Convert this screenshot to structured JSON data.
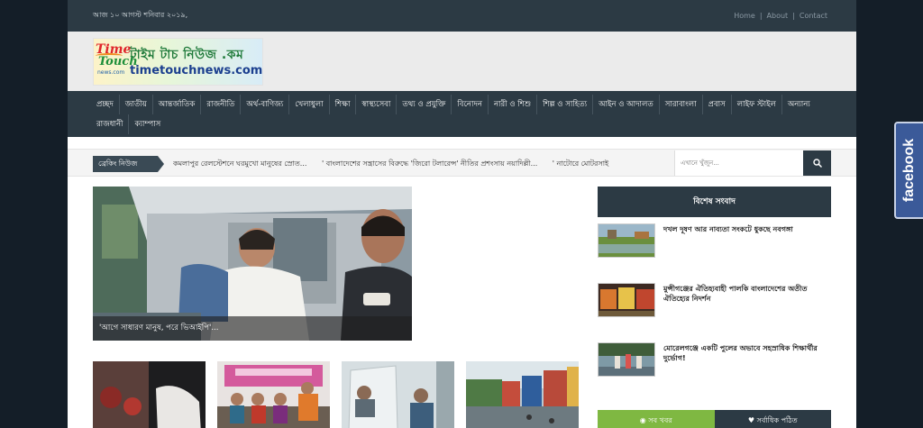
{
  "topbar": {
    "date": "আজ ১০ আগস্ট শনিবার ২০১৯,",
    "links": [
      "Home",
      "About",
      "Contact"
    ]
  },
  "logo": {
    "mark_lines": [
      "Time",
      "Touch",
      "news.com"
    ],
    "bangla": "টাইম টাচ নিউজ .কম",
    "english": "timetouchnews.com"
  },
  "nav": {
    "items": [
      "প্রচ্ছদ",
      "জাতীয়",
      "আন্তর্জাতিক",
      "রাজনীতি",
      "অর্থ-বাণিজ্য",
      "খেলাধুলা",
      "শিক্ষা",
      "স্বাস্থ্যসেবা",
      "তথ্য ও প্রযুক্তি",
      "বিনোদন",
      "নারী ও শিশু",
      "শিল্প ও সাহিত্য",
      "আইন ও আদালত",
      "সারাবাংলা",
      "প্রবাস",
      "লাইফ স্টাইল",
      "অন্যান্য"
    ],
    "items_row2": [
      "রাজধানী",
      "ক্যাম্পাস"
    ]
  },
  "breaking": {
    "label": "ব্রেকিং নিউজ",
    "headlines": [
      "কমলাপুর রেলস্টেশনে ঘরমুখো মানুষের স্রোত...",
      "' বাংলাদেশের সন্ত্রাসের বিরুদ্ধে 'জিরো টলারেন্স' নীতির প্রশংসায় নয়াদিল্লী...",
      "' নাটোরে মোটরসাই"
    ],
    "search_placeholder": "এখানে খুঁজুন..."
  },
  "featured": {
    "caption": "'আগে সাধারণ মানুষ, পরে ভিআইপি'..."
  },
  "sidebar": {
    "heading": "বিশেষ সংবাদ",
    "items": [
      {
        "title": "দখল দূষণ আর নাব্যতা সংকটে ধুকছে নবগঙ্গা"
      },
      {
        "title": "মুন্সীগঞ্জের ঐতিহ্যবাহী পালকি বাংলাদেশের অতীত ঐতিহ্যের নিদর্শন"
      },
      {
        "title": "মোরেলগঞ্জে একটি পুলের অভাবে সহস্রাধিক শিক্ষার্থীর দুর্ভোগ!"
      }
    ],
    "tabs": [
      {
        "label": "সব খবর",
        "icon": "chat-icon"
      },
      {
        "label": "সর্বাধিক পঠিত",
        "icon": "heart-icon"
      }
    ]
  },
  "facebook": {
    "label": "facebook"
  },
  "colors": {
    "dark_bar": "#2c3a44",
    "page_bg": "#141e28",
    "facebook": "#3b5a99",
    "tab_green": "#7fb842"
  }
}
